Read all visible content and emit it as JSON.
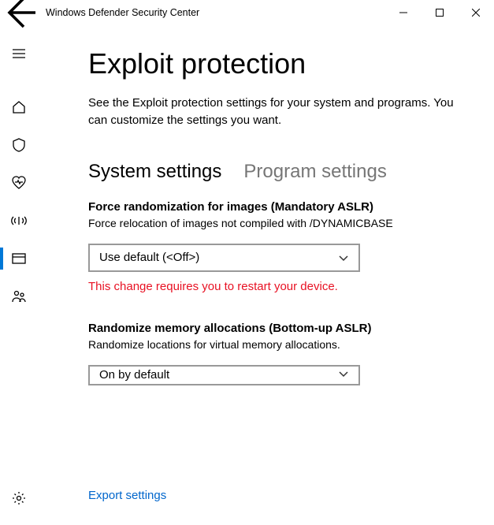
{
  "window": {
    "title": "Windows Defender Security Center"
  },
  "page": {
    "title": "Exploit protection",
    "description": "See the Exploit protection settings for your system and programs.  You can customize the settings you want."
  },
  "tabs": {
    "system": "System settings",
    "program": "Program settings"
  },
  "settings": [
    {
      "title": "Force randomization for images (Mandatory ASLR)",
      "desc": "Force relocation of images not compiled with /DYNAMICBASE",
      "value": "Use default (<Off>)",
      "warning": "This change requires you to restart your device."
    },
    {
      "title": "Randomize memory allocations (Bottom-up ASLR)",
      "desc": "Randomize locations for virtual memory allocations.",
      "value": "On by default",
      "warning": ""
    }
  ],
  "export": {
    "label": "Export settings"
  }
}
